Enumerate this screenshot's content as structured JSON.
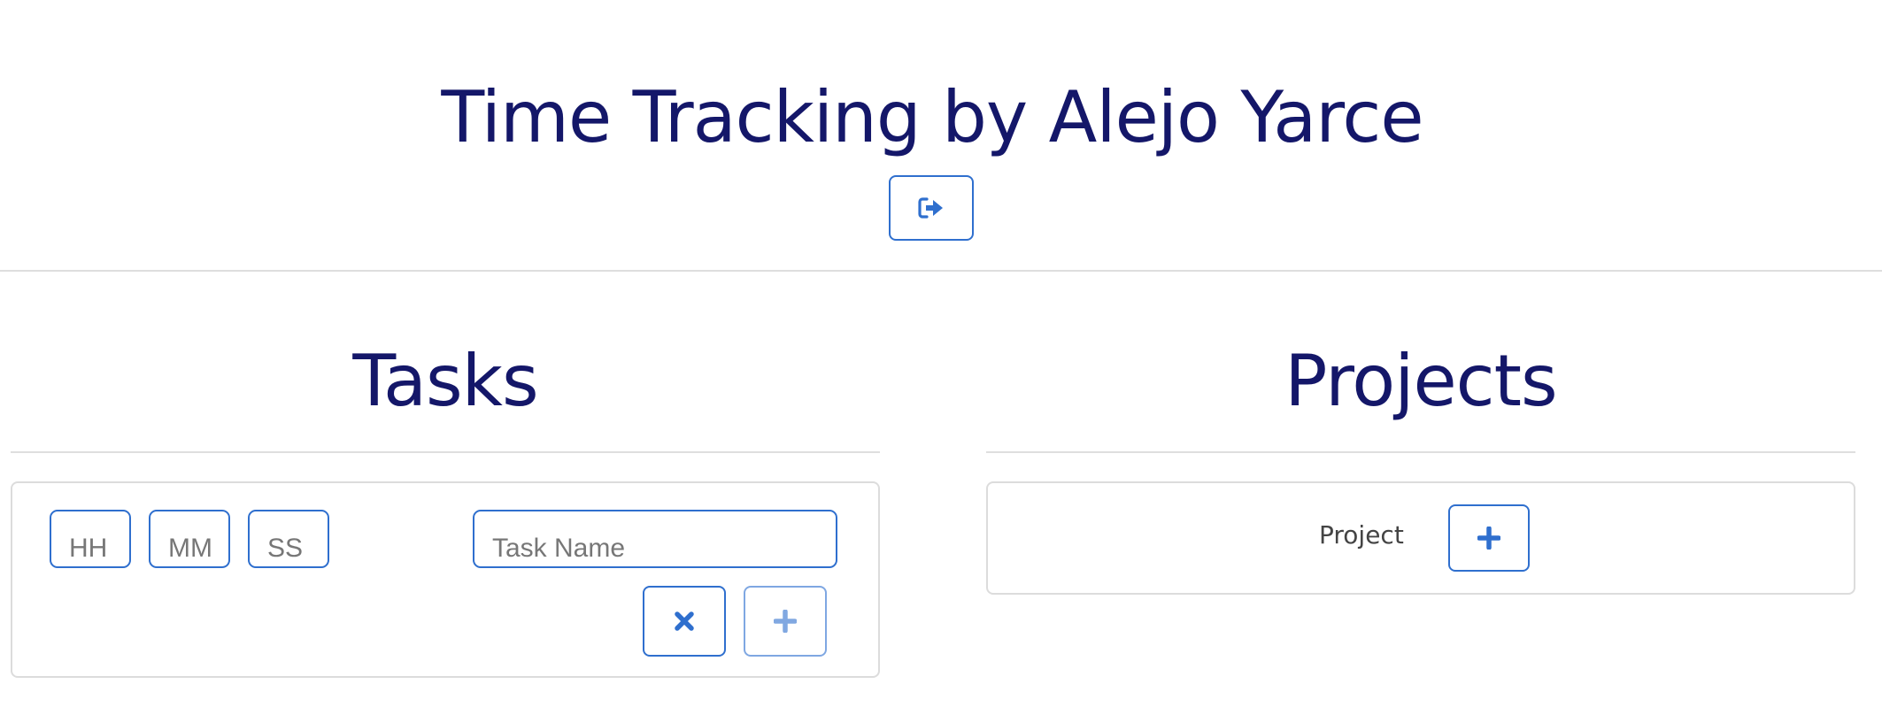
{
  "header": {
    "title": "Time Tracking by Alejo Yarce",
    "logout_icon": "sign-out-icon"
  },
  "tasks": {
    "title": "Tasks",
    "hours_placeholder": "HH",
    "minutes_placeholder": "MM",
    "seconds_placeholder": "SS",
    "task_name_placeholder": "Task Name",
    "cancel_icon": "times-icon",
    "add_icon": "plus-icon"
  },
  "projects": {
    "title": "Projects",
    "project_label": "Project",
    "add_icon": "plus-icon"
  },
  "colors": {
    "title": "#141769",
    "accent": "#2f6fce",
    "divider": "#dedede"
  }
}
